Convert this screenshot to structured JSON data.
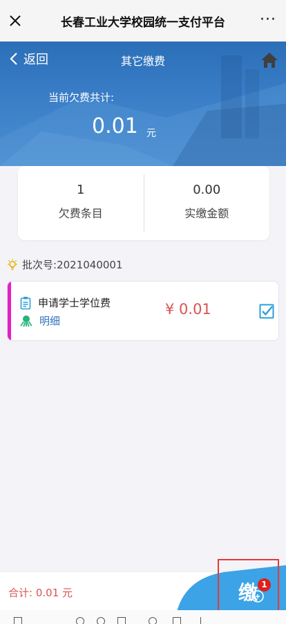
{
  "app": {
    "title": "长春工业大学校园统一支付平台",
    "more_label": "···"
  },
  "nav": {
    "back_label": "返回",
    "title": "其它缴费"
  },
  "summary": {
    "owe_label": "当前欠费共计:",
    "owe_amount": "0.01",
    "owe_unit": "元"
  },
  "stats": {
    "count_value": "1",
    "count_label": "欠费条目",
    "paid_value": "0.00",
    "paid_label": "实缴金额"
  },
  "batch": {
    "label": "批次号:",
    "value": "2021040001"
  },
  "fee_item": {
    "name": "申请学士学位费",
    "detail_label": "明细",
    "price": "¥ 0.01",
    "checked": true
  },
  "footer": {
    "total_label": "合计:",
    "total_value": "0.01 元",
    "pay_glyph": "缴",
    "badge_count": "1"
  },
  "colors": {
    "accent": "#2f6fbf",
    "price": "#d9534f",
    "strip": "#e420c6",
    "hero": "#3a7ec7"
  },
  "icons": [
    "close-icon",
    "more-icon",
    "back-chevron-icon",
    "home-icon",
    "bulb-icon",
    "clipboard-icon",
    "squid-icon",
    "checkbox-icon"
  ]
}
